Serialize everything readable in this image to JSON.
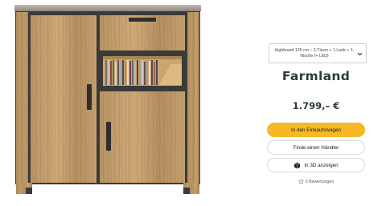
{
  "product": {
    "variant_label": "Highboard 125 cm – 2-Türen + 1-Lade + 1-Nische (+ LED)",
    "title": "Farmland",
    "price": "1.799,– €"
  },
  "actions": {
    "cart_label": "In den Einkaufswagen",
    "dealer_label": "Finde einen Händler",
    "view3d_label": "In 3D anzeigen"
  },
  "reviews": {
    "label": "0 Bewertungen"
  },
  "icons": {
    "select": "chevron-down-icon",
    "view3d": "cube-3d-icon",
    "reviews": "star-outline-icon",
    "image": "product-image"
  },
  "colors": {
    "accent": "#f6b824",
    "title": "#2e3b3a",
    "wood": "#b08c5f",
    "frame": "#3b3a38"
  }
}
